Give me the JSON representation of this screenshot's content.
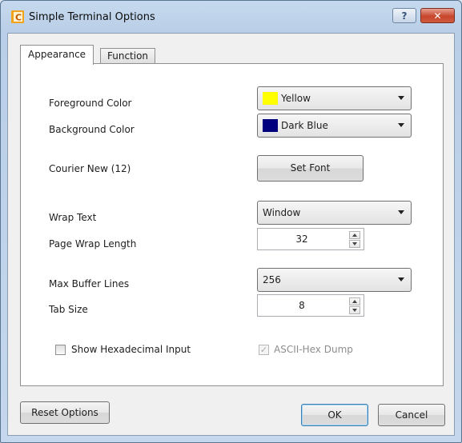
{
  "window": {
    "title": "Simple Terminal Options",
    "help_glyph": "?",
    "close_glyph": "✕"
  },
  "tabs": [
    {
      "label": "Appearance",
      "active": true
    },
    {
      "label": "Function",
      "active": false
    }
  ],
  "appearance": {
    "foreground_label": "Foreground Color",
    "foreground_value": "Yellow",
    "foreground_swatch": "#ffff00",
    "background_label": "Background Color",
    "background_value": "Dark Blue",
    "background_swatch": "#00007f",
    "font_label": "Courier New (12)",
    "set_font_label": "Set Font",
    "wrap_text_label": "Wrap Text",
    "wrap_text_value": "Window",
    "page_wrap_label": "Page Wrap Length",
    "page_wrap_value": "32",
    "max_buffer_label": "Max Buffer Lines",
    "max_buffer_value": "256",
    "tab_size_label": "Tab Size",
    "tab_size_value": "8",
    "show_hex_label": "Show Hexadecimal Input",
    "show_hex_checked": false,
    "ascii_hex_label": "ASCII-Hex Dump",
    "ascii_hex_checked": true,
    "ascii_hex_check_glyph": "✓"
  },
  "footer": {
    "reset_label": "Reset Options",
    "ok_label": "OK",
    "cancel_label": "Cancel"
  }
}
